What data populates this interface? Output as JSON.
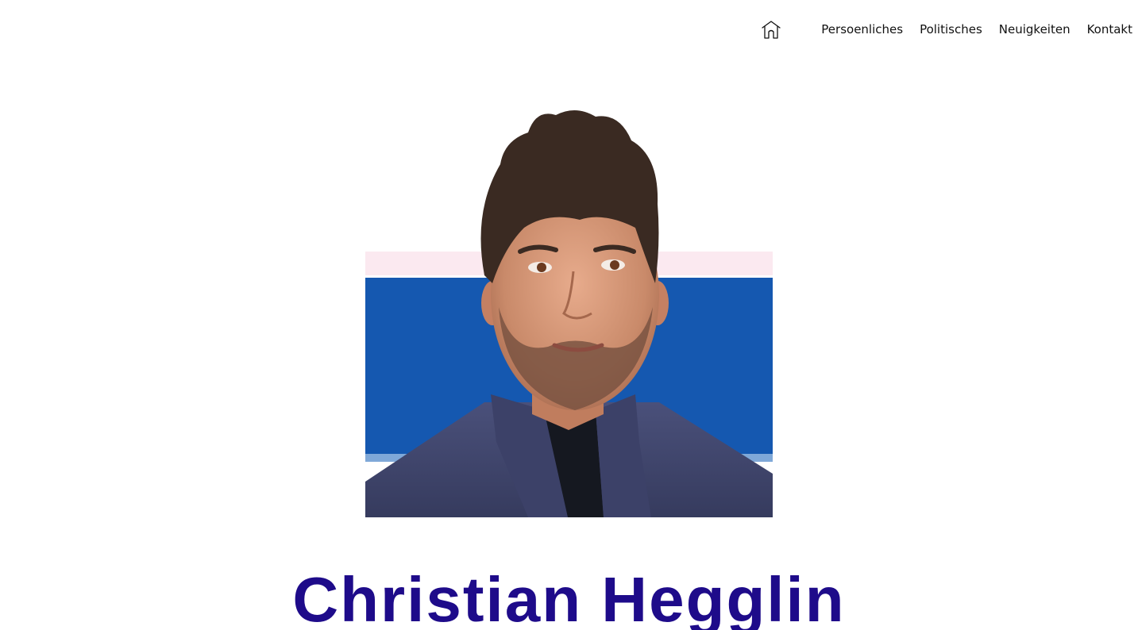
{
  "nav": {
    "home_icon": "house-icon",
    "items": [
      {
        "label": "Persoenliches"
      },
      {
        "label": "Politisches"
      },
      {
        "label": "Neuigkeiten"
      },
      {
        "label": "Kontakt"
      }
    ]
  },
  "hero": {
    "name": "Christian Hegglin",
    "name_color": "#1e0b8a",
    "background_band_color": "#1558b0"
  }
}
